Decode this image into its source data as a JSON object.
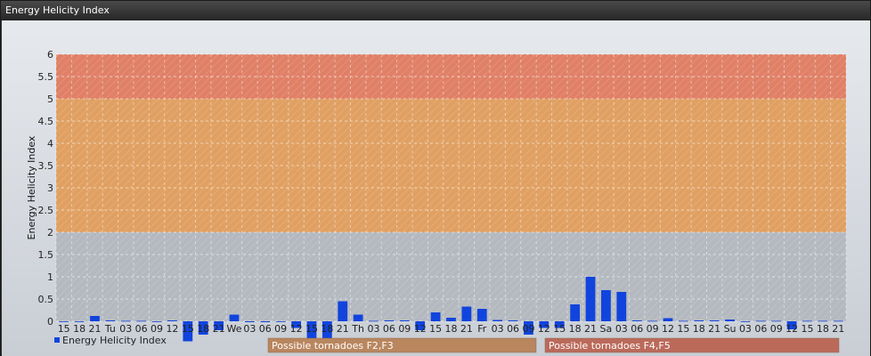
{
  "widget": {
    "title": "Energy Helicity Index"
  },
  "chart_data": {
    "type": "bar",
    "ylabel": "Energy Helicity Index",
    "ylim": [
      0,
      6
    ],
    "yticks": [
      0,
      0.5,
      1,
      1.5,
      2,
      2.5,
      3,
      3.5,
      4,
      4.5,
      5,
      5.5,
      6
    ],
    "ytick_labels": [
      "0",
      "0.5",
      "1",
      "1.5",
      "2",
      "2.5",
      "3",
      "3.5",
      "4",
      "4.5",
      "5",
      "5.5",
      "6"
    ],
    "grid": true,
    "colors": {
      "bar": "#1144dd",
      "band_low": "#b4b9c0",
      "band_mid": "#e0a062",
      "band_high": "#e08066",
      "label_mid": "#b9865e",
      "label_high": "#bb6a5a"
    },
    "bands": [
      {
        "from": 0,
        "to": 2,
        "color": "#b4b9c0"
      },
      {
        "from": 2,
        "to": 5,
        "color": "#e0a062"
      },
      {
        "from": 5,
        "to": 6,
        "color": "#e08066"
      }
    ],
    "band_labels": [
      {
        "label": "Possible tornadoes F2,F3",
        "color": "#b9865e"
      },
      {
        "label": "Possible tornadoes F4,F5",
        "color": "#bb6a5a"
      }
    ],
    "categories": [
      "15",
      "18",
      "21",
      "Tu",
      "03",
      "06",
      "09",
      "12",
      "15",
      "18",
      "21",
      "We",
      "03",
      "06",
      "09",
      "12",
      "15",
      "18",
      "21",
      "Th",
      "03",
      "06",
      "09",
      "12",
      "15",
      "18",
      "21",
      "Fr",
      "03",
      "06",
      "09",
      "12",
      "15",
      "18",
      "21",
      "Sa",
      "03",
      "06",
      "09",
      "12",
      "15",
      "18",
      "21",
      "Su",
      "03",
      "06",
      "09",
      "12",
      "15",
      "18",
      "21"
    ],
    "series": [
      {
        "name": "Energy Helicity Index",
        "values": [
          0.0,
          0.0,
          0.12,
          0.02,
          0.01,
          0.01,
          0.0,
          0.02,
          -0.45,
          -0.3,
          -0.2,
          0.15,
          -0.02,
          -0.02,
          0.0,
          -0.15,
          -0.5,
          -0.4,
          0.45,
          0.15,
          0.01,
          0.02,
          0.02,
          -0.2,
          0.2,
          0.08,
          0.33,
          0.28,
          0.03,
          0.02,
          -0.3,
          -0.15,
          -0.15,
          0.38,
          1.0,
          0.7,
          0.66,
          0.02,
          0.01,
          0.07,
          0.01,
          0.02,
          0.02,
          0.04,
          0.0,
          0.01,
          0.01,
          -0.18,
          0.01,
          0.01,
          0.01
        ]
      }
    ],
    "legend": {
      "placement": "bottom-left",
      "label": "Energy Helicity Index"
    }
  }
}
